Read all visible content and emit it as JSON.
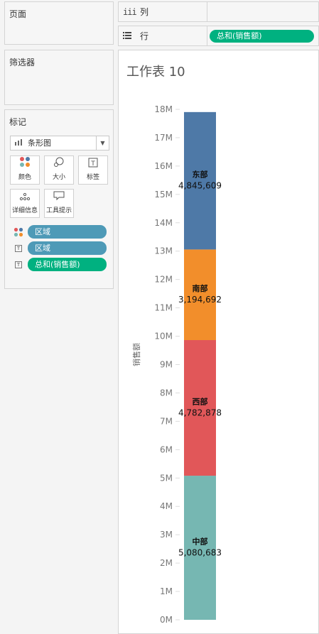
{
  "pages": {
    "title": "页面"
  },
  "filters": {
    "title": "筛选器"
  },
  "marks": {
    "title": "标记",
    "mark_type": "条形图",
    "buttons": [
      {
        "label": "颜色",
        "icon": "color-dots-icon"
      },
      {
        "label": "大小",
        "icon": "size-icon"
      },
      {
        "label": "标签",
        "icon": "label-icon"
      },
      {
        "label": "详细信息",
        "icon": "detail-icon"
      },
      {
        "label": "工具提示",
        "icon": "tooltip-icon"
      }
    ],
    "encodings": [
      {
        "type": "color",
        "field": "区域",
        "color": "#4e9ab7"
      },
      {
        "type": "label",
        "field": "区域",
        "color": "#4e9ab7"
      },
      {
        "type": "label",
        "field": "总和(销售额)",
        "color": "#00b180"
      }
    ]
  },
  "columns_shelf": {
    "label": "列"
  },
  "rows_shelf": {
    "label": "行",
    "pill": "总和(销售额)"
  },
  "sheet": {
    "title": "工作表 10"
  },
  "chart_data": {
    "type": "bar",
    "stacked": true,
    "ylabel": "销售额",
    "ylim": [
      0,
      18000000
    ],
    "ticks": [
      "0M",
      "1M",
      "2M",
      "3M",
      "4M",
      "5M",
      "6M",
      "7M",
      "8M",
      "9M",
      "10M",
      "11M",
      "12M",
      "13M",
      "14M",
      "15M",
      "16M",
      "17M",
      "18M"
    ],
    "series": [
      {
        "name": "中部",
        "value": 5080683,
        "label": "5,080,683",
        "color": "#76b7b2"
      },
      {
        "name": "西部",
        "value": 4782878,
        "label": "4,782,878",
        "color": "#e15759"
      },
      {
        "name": "南部",
        "value": 3194692,
        "label": "3,194,692",
        "color": "#f28e2b"
      },
      {
        "name": "东部",
        "value": 4845609,
        "label": "4,845,609",
        "color": "#4e79a7"
      }
    ]
  }
}
